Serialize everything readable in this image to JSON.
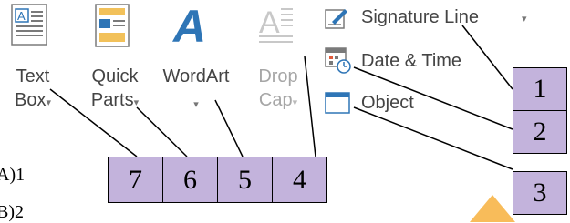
{
  "ribbon": {
    "text_box": {
      "line1": "Text",
      "line2": "Box",
      "caret": "▾"
    },
    "quick_parts": {
      "line1": "Quick",
      "line2": "Parts",
      "caret": "▾"
    },
    "wordart": {
      "line1": "WordArt",
      "caret": "▾"
    },
    "drop_cap": {
      "line1": "Drop",
      "line2": "Cap",
      "caret": "▾",
      "disabled": true
    },
    "signature_line": {
      "label": "Signature Line",
      "caret": "▾"
    },
    "date_time": {
      "label": "Date & Time"
    },
    "object": {
      "label": "Object"
    }
  },
  "callouts": [
    "1",
    "2",
    "3",
    "4",
    "5",
    "6",
    "7"
  ],
  "answers": [
    "A)1",
    "B)2"
  ],
  "colors": {
    "callout_fill": "#c3b3dc",
    "wordart_blue": "#2e75b6",
    "accent": "#f5a623"
  }
}
